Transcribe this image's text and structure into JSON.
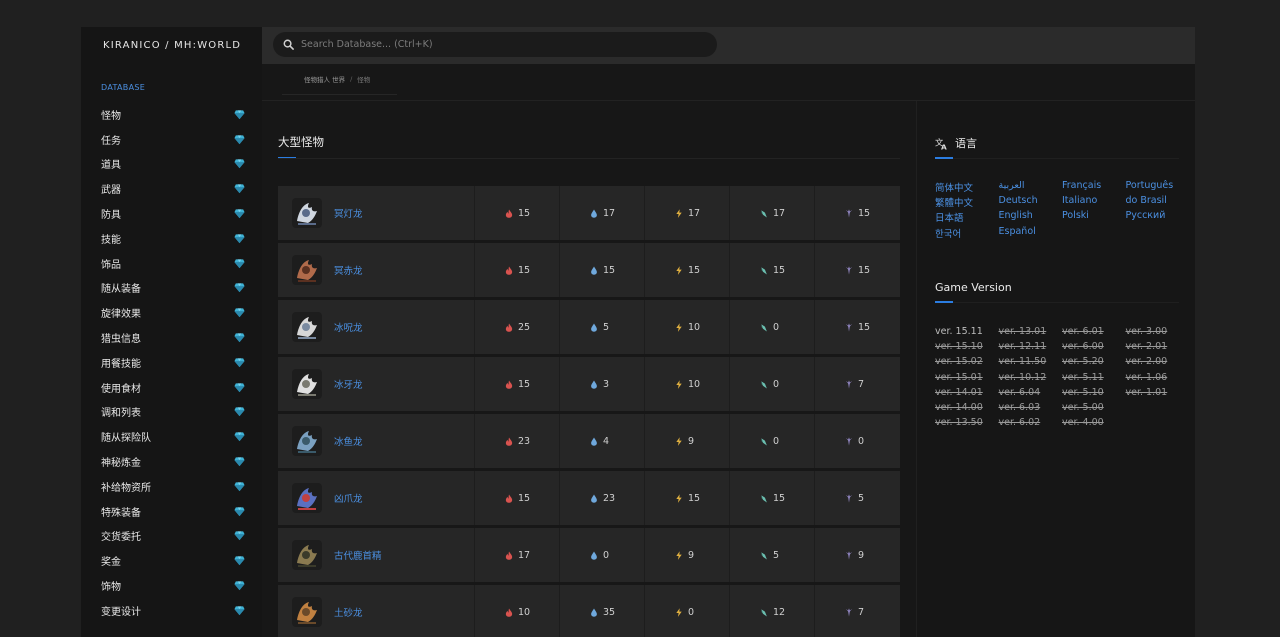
{
  "brand": "KIRANICO / MH:WORLD",
  "search": {
    "placeholder": "Search Database... (Ctrl+K)"
  },
  "sidebar": {
    "heading": "DATABASE",
    "items": [
      "怪物",
      "任务",
      "道具",
      "武器",
      "防具",
      "技能",
      "饰品",
      "随从装备",
      "旋律效果",
      "猎虫信息",
      "用餐技能",
      "使用食材",
      "调和列表",
      "随从探险队",
      "神秘炼金",
      "补给物资所",
      "特殊装备",
      "交货委托",
      "奖金",
      "饰物",
      "变更设计"
    ]
  },
  "breadcrumb": {
    "root": "怪物猎人 世界",
    "sep": "/",
    "current": "怪物"
  },
  "main": {
    "title": "大型怪物"
  },
  "colors": {
    "accent": "#2b7de1",
    "link": "#4b90e2",
    "fire": "#d9534f",
    "water": "#6fa8dc",
    "thunder": "#e0b040",
    "ice": "#6bbfb0",
    "dragon": "#9b8fd0",
    "gem": "#3fb3d6"
  },
  "icons": {
    "elements": [
      "fire-icon",
      "water-icon",
      "thunder-icon",
      "ice-icon",
      "dragon-icon"
    ]
  },
  "monsters": [
    {
      "name": "冥灯龙",
      "fire": "15",
      "water": "17",
      "thunder": "17",
      "ice": "17",
      "dragon": "15"
    },
    {
      "name": "冥赤龙",
      "fire": "15",
      "water": "15",
      "thunder": "15",
      "ice": "15",
      "dragon": "15"
    },
    {
      "name": "冰呪龙",
      "fire": "25",
      "water": "5",
      "thunder": "10",
      "ice": "0",
      "dragon": "15"
    },
    {
      "name": "冰牙龙",
      "fire": "15",
      "water": "3",
      "thunder": "10",
      "ice": "0",
      "dragon": "7"
    },
    {
      "name": "冰鱼龙",
      "fire": "23",
      "water": "4",
      "thunder": "9",
      "ice": "0",
      "dragon": "0"
    },
    {
      "name": "凶爪龙",
      "fire": "15",
      "water": "23",
      "thunder": "15",
      "ice": "15",
      "dragon": "5"
    },
    {
      "name": "古代鹿首精",
      "fire": "17",
      "water": "0",
      "thunder": "9",
      "ice": "5",
      "dragon": "9"
    },
    {
      "name": "土砂龙",
      "fire": "10",
      "water": "35",
      "thunder": "0",
      "ice": "12",
      "dragon": "7"
    }
  ],
  "language": {
    "title": "语言",
    "options": [
      "简体中文",
      "繁體中文",
      "日本語",
      "한국어",
      "العربية",
      "Deutsch",
      "English",
      "Español",
      "Français",
      "Italiano",
      "Polski",
      "",
      "Português",
      "do Brasil",
      "Русский",
      ""
    ]
  },
  "game_version": {
    "title": "Game Version",
    "current": "ver. 15.11",
    "versions": [
      "ver. 15.11",
      "ver. 15.10",
      "ver. 15.02",
      "ver. 15.01",
      "ver. 14.01",
      "ver. 14.00",
      "ver. 13.50",
      "ver. 13.01",
      "ver. 12.11",
      "ver. 11.50",
      "ver. 10.12",
      "ver. 6.04",
      "ver. 6.03",
      "ver. 6.02",
      "ver. 6.01",
      "ver. 6.00",
      "ver. 5.20",
      "ver. 5.11",
      "ver. 5.10",
      "ver. 5.00",
      "ver. 4.00",
      "ver. 3.00",
      "ver. 2.01",
      "ver. 2.00",
      "ver. 1.06",
      "ver. 1.01"
    ]
  }
}
